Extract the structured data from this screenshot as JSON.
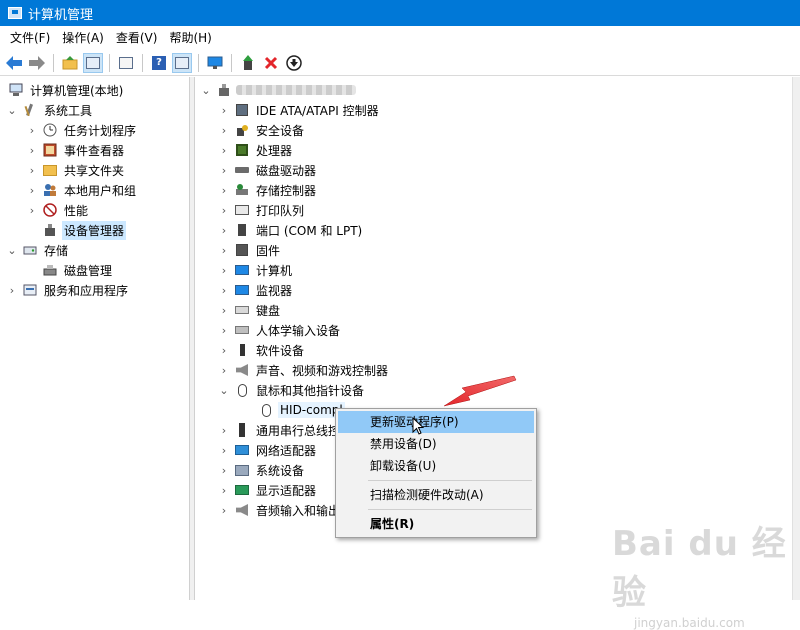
{
  "window": {
    "title": "计算机管理"
  },
  "menubar": [
    "文件(F)",
    "操作(A)",
    "查看(V)",
    "帮助(H)"
  ],
  "toolbar": {
    "icons": [
      "back-icon",
      "forward-icon",
      "up-folder-icon",
      "show-hide-tree-icon",
      "properties-icon",
      "help-icon",
      "action-pane-icon",
      "monitor-icon",
      "update-driver-icon",
      "uninstall-icon",
      "download-icon"
    ]
  },
  "left_tree": {
    "root": "计算机管理(本地)",
    "system_tools": "系统工具",
    "task_scheduler": "任务计划程序",
    "event_viewer": "事件查看器",
    "shared_folders": "共享文件夹",
    "local_users": "本地用户和组",
    "performance": "性能",
    "device_manager": "设备管理器",
    "storage": "存储",
    "disk_management": "磁盘管理",
    "services_apps": "服务和应用程序"
  },
  "device_tree": {
    "categories": [
      "IDE ATA/ATAPI 控制器",
      "安全设备",
      "处理器",
      "磁盘驱动器",
      "存储控制器",
      "打印队列",
      "端口 (COM 和 LPT)",
      "固件",
      "计算机",
      "监视器",
      "键盘",
      "人体学输入设备",
      "软件设备",
      "声音、视频和游戏控制器",
      "鼠标和其他指针设备"
    ],
    "expanded_child": "HID-compl",
    "after_categories": [
      "通用串行总线控",
      "网络适配器",
      "系统设备",
      "显示适配器",
      "音频输入和输出"
    ]
  },
  "context_menu": {
    "update_driver": "更新驱动程序(P)",
    "disable": "禁用设备(D)",
    "uninstall": "卸载设备(U)",
    "scan": "扫描检测硬件改动(A)",
    "properties": "属性(R)"
  },
  "watermark": {
    "brand": "Bai du 经验",
    "sub": "jingyan.baidu.com"
  },
  "colors": {
    "titlebar": "#0078d7",
    "menu_hover": "#91c9f7",
    "selected": "#cce8ff",
    "arrow": "#e3262b"
  }
}
